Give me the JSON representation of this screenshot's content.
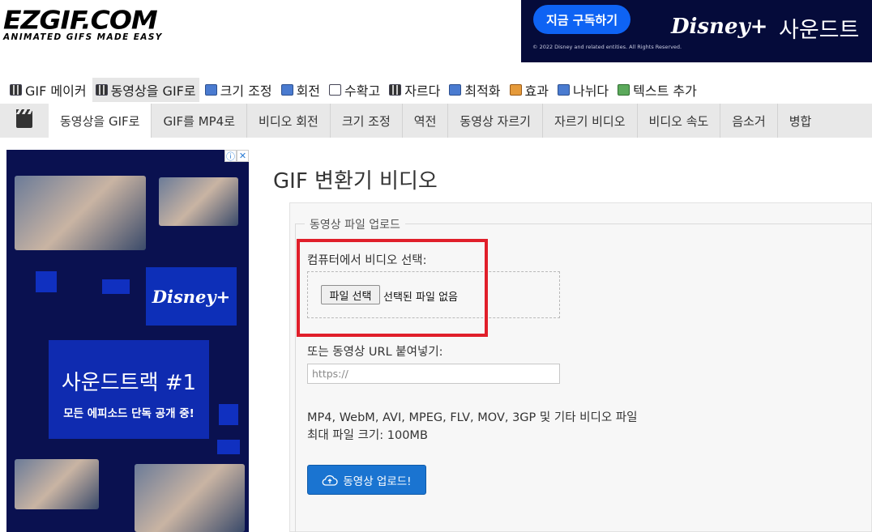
{
  "header": {
    "logo_main": "EZGIF.COM",
    "logo_sub": "ANIMATED GIFS MADE EASY"
  },
  "top_ad": {
    "button": "지금 구독하기",
    "copyright": "© 2022 Disney and related entities. All Rights Reserved.",
    "brand": "Disney+",
    "tail": "사운드트"
  },
  "main_nav": [
    {
      "label": "GIF 메이커",
      "icon": "gif-maker-icon"
    },
    {
      "label": "동영상을 GIF로",
      "icon": "video-to-gif-icon",
      "active": true
    },
    {
      "label": "크기 조정",
      "icon": "resize-icon"
    },
    {
      "label": "회전",
      "icon": "rotate-icon"
    },
    {
      "label": "수확고",
      "icon": "crop-icon"
    },
    {
      "label": "자르다",
      "icon": "cut-icon"
    },
    {
      "label": "최적화",
      "icon": "optimize-icon"
    },
    {
      "label": "효과",
      "icon": "effects-icon"
    },
    {
      "label": "나뉘다",
      "icon": "split-icon"
    },
    {
      "label": "텍스트 추가",
      "icon": "add-text-icon"
    }
  ],
  "sub_nav": [
    {
      "label": "동영상을 GIF로",
      "active": true
    },
    {
      "label": "GIF를 MP4로"
    },
    {
      "label": "비디오 회전"
    },
    {
      "label": "크기 조정"
    },
    {
      "label": "역전"
    },
    {
      "label": "동영상 자르기"
    },
    {
      "label": "자르기 비디오"
    },
    {
      "label": "비디오 속도"
    },
    {
      "label": "음소거"
    },
    {
      "label": "병합"
    }
  ],
  "side_ad": {
    "brand": "Disney+",
    "promo_title": "사운드트랙 #1",
    "promo_sub": "모든 에피소드 단독 공개 중!"
  },
  "main": {
    "title": "GIF 변환기 비디오",
    "legend": "동영상 파일 업로드",
    "select_label": "컴퓨터에서 비디오 선택:",
    "file_button": "파일 선택",
    "file_status": "선택된 파일 없음",
    "url_label": "또는 동영상 URL 붙여넣기:",
    "url_placeholder": "https://",
    "formats": "MP4, WebM, AVI, MPEG, FLV, MOV, 3GP 및 기타 비디오 파일",
    "max_size": "최대 파일 크기: 100MB",
    "upload_button": "동영상 업로드!"
  },
  "colors": {
    "accent": "#1a74d1",
    "highlight": "#e01f2a",
    "ad_bg": "#0a1150"
  }
}
